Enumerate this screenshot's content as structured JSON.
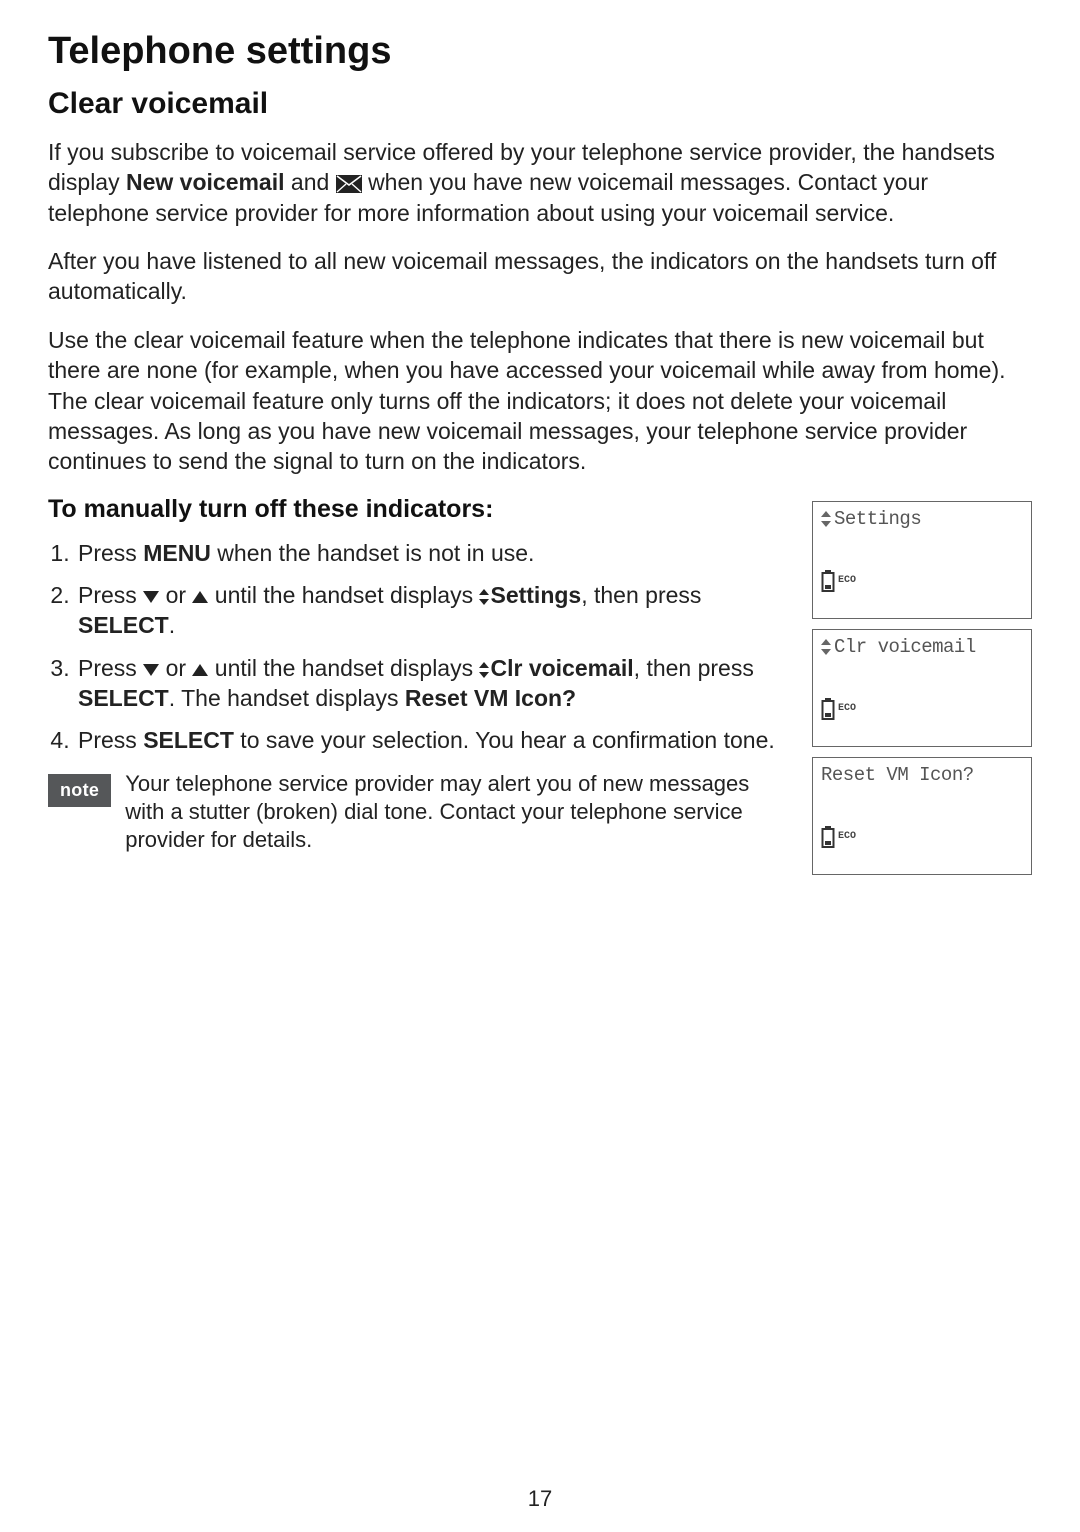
{
  "page": {
    "title": "Telephone settings",
    "section": "Clear voicemail",
    "page_number": "17"
  },
  "paragraphs": {
    "p1_a": "If you subscribe to voicemail service offered by your telephone service provider, the handsets display ",
    "p1_bold": "New voicemail",
    "p1_b": " and ",
    "p1_c": " when you have new voicemail messages. Contact your telephone service provider for more information about using your voicemail service.",
    "p2": "After you have listened to all new voicemail messages, the indicators on the handsets turn off automatically.",
    "p3": "Use the clear voicemail feature when the telephone indicates that there is new voicemail but there are none (for example, when you have accessed your voicemail while away from home). The clear voicemail feature only turns off the indicators; it does not delete your voicemail messages. As long as you have new voicemail messages, your telephone service provider continues to send the signal to turn on the indicators."
  },
  "instructions": {
    "heading": "To manually turn off these indicators:",
    "step1_a": "Press ",
    "step1_menu": "MENU",
    "step1_b": " when the handset is not in use.",
    "step2_a": "Press ",
    "step2_b": " or ",
    "step2_c": " until the handset displays ",
    "step2_settings": "Settings",
    "step2_d": ", then press ",
    "step2_select": "SELECT",
    "step2_e": ".",
    "step3_a": "Press ",
    "step3_b": " or ",
    "step3_c": " until the handset displays ",
    "step3_clr": "Clr voicemail",
    "step3_d": ", then press ",
    "step3_select": "SELECT",
    "step3_e": ". The handset displays ",
    "step3_reset": "Reset VM Icon?",
    "step4_a": "Press ",
    "step4_select": "SELECT",
    "step4_b": " to save your selection. You hear a confirmation tone."
  },
  "note": {
    "label": "note",
    "text": "Your telephone service provider may alert you of new messages with a stutter (broken) dial tone. Contact your telephone service provider for details."
  },
  "screens": {
    "s1_text": "Settings",
    "s2_text": "Clr voicemail",
    "s3_text": "Reset VM Icon?",
    "eco": "ECO"
  }
}
